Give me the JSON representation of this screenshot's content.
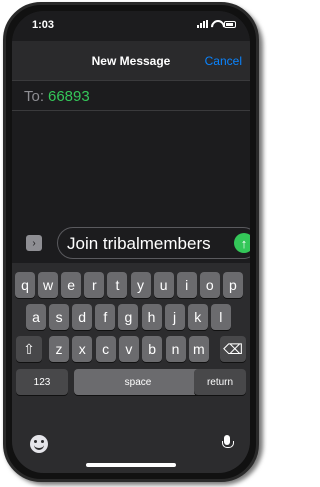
{
  "status": {
    "time": "1:03"
  },
  "nav": {
    "title": "New Message",
    "cancel": "Cancel"
  },
  "recipient": {
    "label": "To:",
    "value": "66893"
  },
  "compose": {
    "text": "Join tribalmembers",
    "send_icon": "arrow-up-icon",
    "apps_icon": "chevron-right-icon"
  },
  "keyboard": {
    "row1": [
      "q",
      "w",
      "e",
      "r",
      "t",
      "y",
      "u",
      "i",
      "o",
      "p"
    ],
    "row2": [
      "a",
      "s",
      "d",
      "f",
      "g",
      "h",
      "j",
      "k",
      "l"
    ],
    "row3": [
      "z",
      "x",
      "c",
      "v",
      "b",
      "n",
      "m"
    ],
    "shift": "⇧",
    "delete": "⌫",
    "numbers": "123",
    "space": "space",
    "return": "return"
  },
  "colors": {
    "accent": "#0a84ff",
    "recipient": "#34c759",
    "send": "#34c759"
  }
}
